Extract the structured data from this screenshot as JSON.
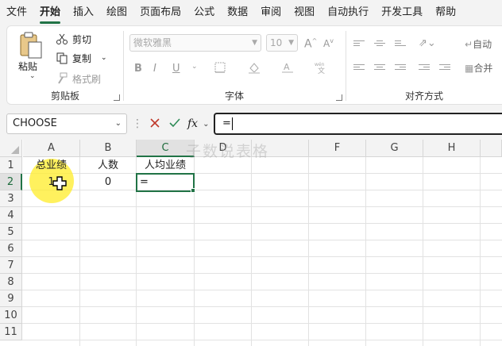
{
  "menu": {
    "tabs": [
      "文件",
      "开始",
      "插入",
      "绘图",
      "页面布局",
      "公式",
      "数据",
      "审阅",
      "视图",
      "自动执行",
      "开发工具",
      "帮助"
    ],
    "active_index": 1
  },
  "ribbon": {
    "clipboard": {
      "paste_label": "粘贴",
      "cut_label": "剪切",
      "copy_label": "复制",
      "format_painter_label": "格式刷",
      "group_label": "剪贴板"
    },
    "font": {
      "font_name": "微软雅黑",
      "font_size": "10",
      "bold": "B",
      "italic": "I",
      "underline": "U",
      "group_label": "字体"
    },
    "alignment": {
      "wrap_label": "自动",
      "merge_label": "合并",
      "group_label": "对齐方式"
    }
  },
  "formula_bar": {
    "name_box": "CHOOSE",
    "fx_label": "fx",
    "formula": "="
  },
  "sheet": {
    "columns": [
      "A",
      "B",
      "C",
      "D",
      "F",
      "G",
      "H"
    ],
    "rows": [
      "1",
      "2",
      "3",
      "4",
      "5",
      "6",
      "7",
      "8",
      "9",
      "10",
      "11"
    ],
    "cells": {
      "A1": "总业绩",
      "B1": "人数",
      "C1": "人均业绩",
      "A2": "1",
      "B2": "0",
      "C2": "="
    },
    "active_cell": "C2",
    "watermark": "子数说表格"
  },
  "colors": {
    "accent": "#217346",
    "highlight": "#ffec28"
  }
}
